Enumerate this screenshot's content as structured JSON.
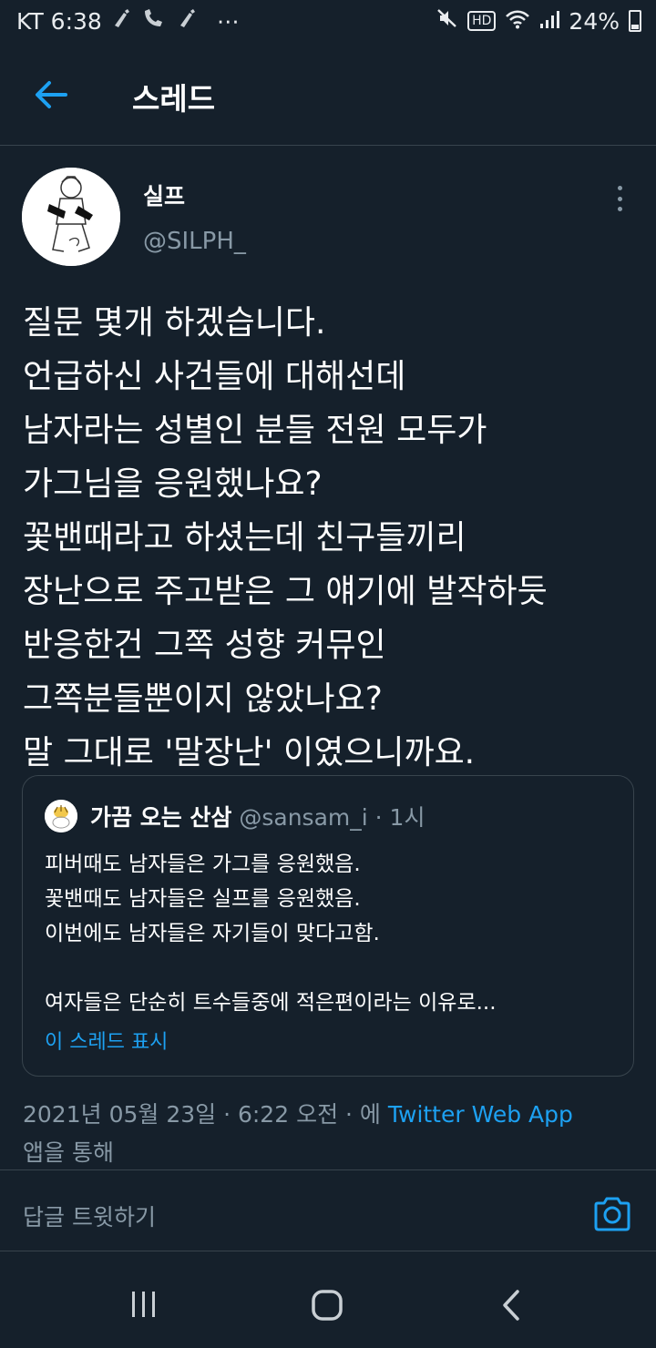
{
  "status_bar": {
    "carrier_time": "KT 6:38",
    "more": "⋯",
    "hd": "HD",
    "battery": "24%"
  },
  "header": {
    "title": "스레드"
  },
  "tweet": {
    "author_name": "실프",
    "author_handle": "@SILPH_",
    "lines": [
      "질문 몇개 하겠습니다.",
      "언급하신 사건들에 대해선데",
      "남자라는 성별인 분들 전원 모두가",
      "가그님을 응원했나요?",
      "꽃밴때라고 하셨는데 친구들끼리",
      "장난으로 주고받은 그 얘기에 발작하듯",
      "반응한건 그쪽 성향 커뮤인",
      "그쪽분들뿐이지 않았나요?",
      "말 그대로 '말장난' 이였으니까요."
    ],
    "timestamp": "2021년 05월 23일 · 6:22 오전 · 에 ",
    "via_app": "Twitter Web App",
    "via_suffix": "앱을 통해"
  },
  "quote": {
    "name": "가끔 오는 산삼",
    "handle_time": " @sansam_i · 1시",
    "lines": [
      "피버때도 남자들은 가그를 응원했음.",
      "꽃밴때도 남자들은 실프를 응원했음.",
      "이번에도 남자들은 자기들이 맞다고함.",
      "",
      "여자들은 단순히 트수들중에 적은편이라는 이유로..."
    ],
    "show_thread": "이 스레드 표시"
  },
  "reply": {
    "placeholder": "답글 트윗하기"
  },
  "colors": {
    "background": "#15202b",
    "accent": "#1da1f2",
    "muted": "#8899a6",
    "divider": "#38444d"
  },
  "icons": {
    "back": "arrow-left-icon",
    "more": "more-vertical-icon",
    "camera": "camera-icon",
    "nav_recents": "recents-icon",
    "nav_home": "home-icon",
    "nav_back": "chevron-left-icon"
  }
}
